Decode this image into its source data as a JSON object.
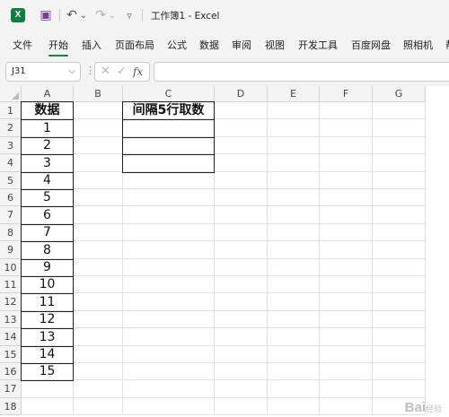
{
  "window": {
    "title": "工作簿1  -  Excel"
  },
  "app": {
    "logo_letter": "X"
  },
  "quick_access": {
    "save": "▣",
    "undo": "↶",
    "redo": "↷",
    "more": "⌄",
    "customize": "▿"
  },
  "ribbon": {
    "tabs": [
      "文件",
      "开始",
      "插入",
      "页面布局",
      "公式",
      "数据",
      "审阅",
      "视图",
      "开发工具",
      "百度网盘",
      "照相机",
      "帮"
    ],
    "active_tab": "开始"
  },
  "formula_bar": {
    "name_box": "J31",
    "cancel_glyph": "✕",
    "enter_glyph": "✓",
    "fx_glyph": "fx",
    "formula": ""
  },
  "sheet": {
    "columns": [
      "A",
      "B",
      "C",
      "D",
      "E",
      "F",
      "G"
    ],
    "rows": [
      "1",
      "2",
      "3",
      "4",
      "5",
      "6",
      "7",
      "8",
      "9",
      "10",
      "11",
      "12",
      "13",
      "14",
      "15",
      "16",
      "17",
      "18"
    ],
    "column_a": [
      "数据",
      "1",
      "2",
      "3",
      "4",
      "5",
      "6",
      "7",
      "8",
      "9",
      "10",
      "11",
      "12",
      "13",
      "14",
      "15"
    ],
    "column_c": [
      "间隔5行取数",
      "",
      "",
      ""
    ]
  },
  "watermark": {
    "text": "Bai",
    "suffix": "经验"
  },
  "colors": {
    "accent": "#107c41",
    "grid_line": "#e1e1e1",
    "header_bg": "#f3f3f3"
  }
}
